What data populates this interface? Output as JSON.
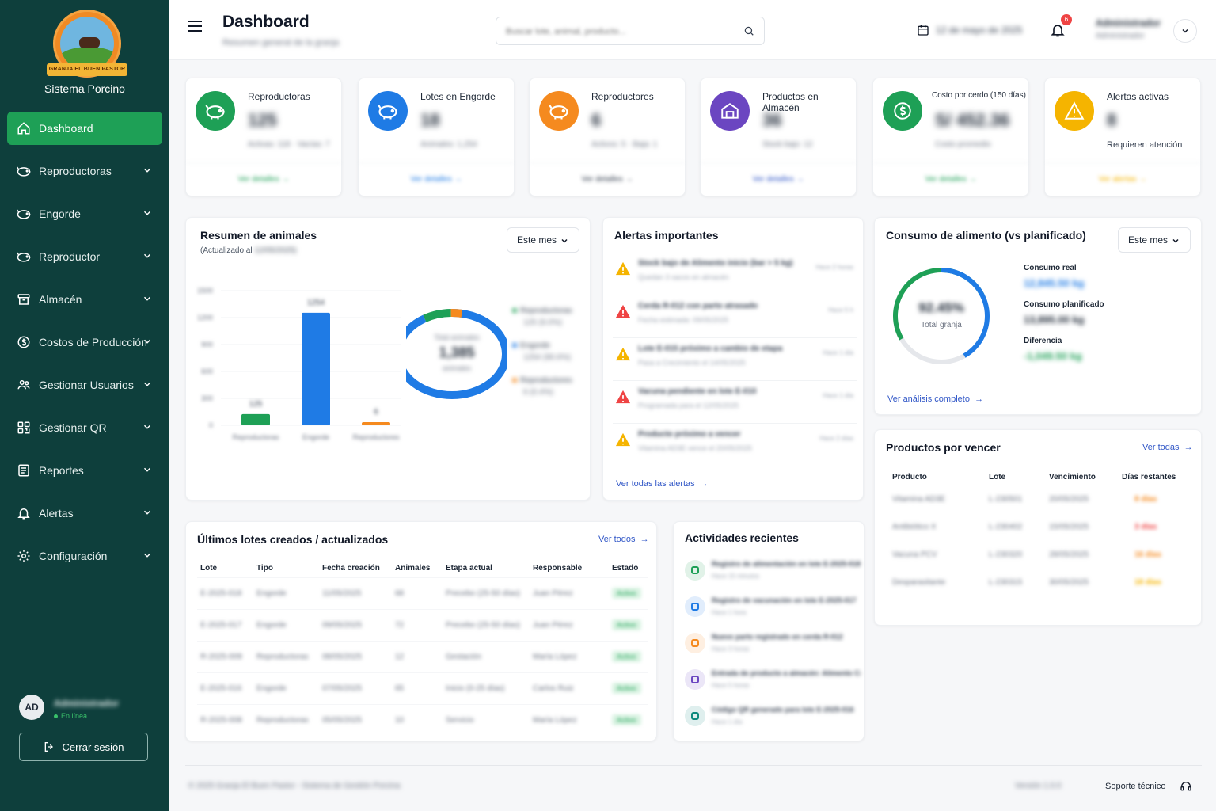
{
  "sidebar": {
    "logo_text": "GRANJA EL BUEN PASTOR",
    "app_name": "Sistema Porcino",
    "items": [
      {
        "label": "Dashboard"
      },
      {
        "label": "Reproductoras"
      },
      {
        "label": "Engorde"
      },
      {
        "label": "Reproductor"
      },
      {
        "label": "Almacén"
      },
      {
        "label": "Costos de Producción"
      },
      {
        "label": "Gestionar Usuarios"
      },
      {
        "label": "Gestionar QR"
      },
      {
        "label": "Reportes"
      },
      {
        "label": "Alertas"
      },
      {
        "label": "Configuración"
      }
    ],
    "user": {
      "initials": "AD",
      "name": "Administrador",
      "status": "En línea"
    },
    "logout_label": "Cerrar sesión"
  },
  "header": {
    "title": "Dashboard",
    "subtitle": "Resumen general de la granja",
    "search_placeholder": "Buscar lote, animal, producto...",
    "date": "12 de mayo de 2025",
    "notifications_count": "6",
    "user_name": "Administrador",
    "user_role": "Administrador"
  },
  "stats": [
    {
      "label": "Reproductoras",
      "value": "125",
      "sub": "Activas: 118 · Vacías: 7",
      "link": "Ver detalles",
      "color": "#1ea056"
    },
    {
      "label": "Lotes en Engorde",
      "value": "18",
      "sub": "Animales: 1,254",
      "link": "Ver detalles",
      "color": "#1f7be5"
    },
    {
      "label": "Reproductores",
      "value": "6",
      "sub": "Activos: 5 · Baja: 1",
      "link": "Ver detalles",
      "color": "#f58a1f"
    },
    {
      "label": "Productos en Almacén",
      "value": "36",
      "sub": "Stock bajo: 12",
      "link": "Ver detalles",
      "color": "#6b46c1"
    },
    {
      "label": "Costo por cerdo (150 días)",
      "value": "S/ 452.36",
      "sub": "Costo promedio",
      "link": "Ver detalles",
      "color": "#1ea056"
    },
    {
      "label": "Alertas activas",
      "value": "8",
      "sub": "Requieren atención",
      "link": "Ver alertas",
      "color": "#f5b400"
    }
  ],
  "resumen": {
    "title": "Resumen de animales",
    "updated_prefix": "(Actualizado al",
    "updated_date": "12/05/2025)",
    "period": "Este mes",
    "donut_label": "Total animales",
    "donut_value": "1,385",
    "donut_unit": "animales",
    "legend": [
      {
        "name": "Reproductoras",
        "detail": "125 (9.0%)",
        "color": "#1ea056"
      },
      {
        "name": "Engorde",
        "detail": "1254 (90.6%)",
        "color": "#1f7be5"
      },
      {
        "name": "Reproductores",
        "detail": "6 (0.4%)",
        "color": "#f58a1f"
      }
    ]
  },
  "chart_data": {
    "type": "bar",
    "categories": [
      "Reproductoras",
      "Engorde",
      "Reproductores"
    ],
    "values": [
      125,
      1254,
      6
    ],
    "ylim": [
      0,
      1500
    ],
    "yticks": [
      "1500",
      "1200",
      "900",
      "600",
      "300",
      "0"
    ],
    "colors": [
      "#1ea056",
      "#1f7be5",
      "#f58a1f"
    ]
  },
  "alerts": {
    "title": "Alertas importantes",
    "items": [
      {
        "title": "Stock bajo de Alimento inicio (bar > 5 kg)",
        "detail": "Quedan 3 sacos en almacén",
        "time": "Hace 2 horas",
        "type": "warning"
      },
      {
        "title": "Cerda R-012 con parto atrasado",
        "detail": "Fecha estimada: 09/05/2025",
        "time": "Hace 5 h",
        "type": "danger"
      },
      {
        "title": "Lote E-015 próximo a cambio de etapa",
        "detail": "Pasa a Crecimiento el 14/05/2025",
        "time": "Hace 1 día",
        "type": "warning"
      },
      {
        "title": "Vacuna pendiente en lote E-010",
        "detail": "Programada para el 12/05/2025",
        "time": "Hace 1 día",
        "type": "danger"
      },
      {
        "title": "Producto próximo a vencer",
        "detail": "Vitamina AD3E vence el 20/05/2025",
        "time": "Hace 2 días",
        "type": "warning"
      }
    ],
    "see_all": "Ver todas las alertas"
  },
  "consumo": {
    "title": "Consumo de alimento (vs planificado)",
    "period": "Este mes",
    "percent": "92.45%",
    "percent_fraction": 0.9245,
    "center_label": "Total granja",
    "real_label": "Consumo real",
    "real_value": "12,845.50 kg",
    "plan_label": "Consumo planificado",
    "plan_value": "13,895.00 kg",
    "diff_label": "Diferencia",
    "diff_value": "-1,049.50 kg",
    "link": "Ver análisis completo"
  },
  "productos": {
    "title": "Productos por vencer",
    "see_all": "Ver todas",
    "headers": [
      "Producto",
      "Lote",
      "Vencimiento",
      "Días restantes"
    ],
    "rows": [
      {
        "producto": "Vitamina AD3E",
        "lote": "L-230501",
        "venc": "20/05/2025",
        "dias": "8 días",
        "color": "#f58a1f"
      },
      {
        "producto": "Antibiótico X",
        "lote": "L-230402",
        "venc": "15/05/2025",
        "dias": "3 días",
        "color": "#ef4444"
      },
      {
        "producto": "Vacuna PCV",
        "lote": "L-230320",
        "venc": "28/05/2025",
        "dias": "16 días",
        "color": "#f58a1f"
      },
      {
        "producto": "Desparasitante",
        "lote": "L-230315",
        "venc": "30/05/2025",
        "dias": "18 días",
        "color": "#f5b400"
      }
    ]
  },
  "lotes": {
    "title": "Últimos lotes creados / actualizados",
    "see_all": "Ver todos",
    "headers": [
      "Lote",
      "Tipo",
      "Fecha creación",
      "Animales",
      "Etapa actual",
      "Responsable",
      "Estado"
    ],
    "rows": [
      {
        "lote": "E-2025-018",
        "tipo": "Engorde",
        "fecha": "11/05/2025",
        "animales": "68",
        "etapa": "Precebo (25-50 días)",
        "resp": "Juan Pérez",
        "estado": "Activo"
      },
      {
        "lote": "E-2025-017",
        "tipo": "Engorde",
        "fecha": "09/05/2025",
        "animales": "72",
        "etapa": "Precebo (25-50 días)",
        "resp": "Juan Pérez",
        "estado": "Activo"
      },
      {
        "lote": "R-2025-009",
        "tipo": "Reproductoras",
        "fecha": "08/05/2025",
        "animales": "12",
        "etapa": "Gestación",
        "resp": "María López",
        "estado": "Activo"
      },
      {
        "lote": "E-2025-016",
        "tipo": "Engorde",
        "fecha": "07/05/2025",
        "animales": "65",
        "etapa": "Inicio (0-25 días)",
        "resp": "Carlos Ruiz",
        "estado": "Activo"
      },
      {
        "lote": "R-2025-008",
        "tipo": "Reproductoras",
        "fecha": "05/05/2025",
        "animales": "10",
        "etapa": "Servicio",
        "resp": "María López",
        "estado": "Activo"
      }
    ]
  },
  "actividades": {
    "title": "Actividades recientes",
    "items": [
      {
        "text": "Registro de alimentación en lote E-2025-018",
        "time": "Hace 15 minutos",
        "color": "#1ea056"
      },
      {
        "text": "Registro de vacunación en lote E-2025-017",
        "time": "Hace 1 hora",
        "color": "#1f7be5"
      },
      {
        "text": "Nuevo parto registrado en cerda R-012",
        "time": "Hace 3 horas",
        "color": "#f58a1f"
      },
      {
        "text": "Entrada de producto a almacén: Alimento Crecimiento",
        "time": "Hace 5 horas",
        "color": "#6b46c1"
      },
      {
        "text": "Código QR generado para lote E-2025-016",
        "time": "Hace 1 día",
        "color": "#0e8a7e"
      }
    ]
  },
  "footer": {
    "copyright": "© 2025 Granja El Buen Pastor - Sistema de Gestión Porcina",
    "version": "Versión 1.0.0",
    "support": "Soporte técnico"
  }
}
